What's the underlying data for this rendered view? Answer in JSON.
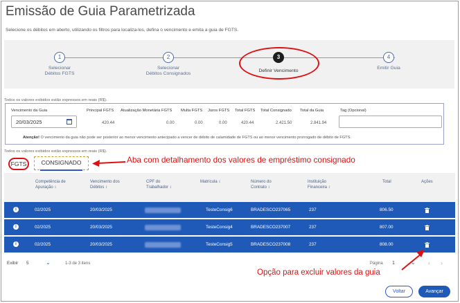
{
  "header": {
    "title": "Emissão de Guia Parametrizada",
    "subtitle": "Selecione os débitos em aberto, utilizando os filtros para localiza-los, defina o vencimento e emita a guia de FGTS."
  },
  "stepper": {
    "steps": [
      {
        "number": "1",
        "label_line1": "Selecionar",
        "label_line2": "Débitos FGTS"
      },
      {
        "number": "2",
        "label_line1": "Selecionar",
        "label_line2": "Débitos Consignados"
      },
      {
        "number": "3",
        "label_line1": "Definir Vencimento",
        "label_line2": ""
      },
      {
        "number": "4",
        "label_line1": "Emitir Guia",
        "label_line2": ""
      }
    ],
    "active_step": 3
  },
  "notes": {
    "reais_top": "Todos os valores exibidos estão expressos em reais (R$).",
    "reais_mid": "Todos os valores exibidos estão expressos em reais (R$)."
  },
  "vencimento": {
    "headers": {
      "vencimento": "Vencimento da Guia",
      "principal": "Principal FGTS",
      "atualizacao": "Atualização Monetária FGTS",
      "multa": "Multa FGTS",
      "juros": "Juros FGTS",
      "total_fgts": "Total FGTS",
      "total_consig": "Total Consignado",
      "total_guia": "Total da Guia",
      "tag": "Tag (Opcional)"
    },
    "values": {
      "vencimento": "20/03/2025",
      "principal": "420.44",
      "atualizacao": "0.00",
      "multa": "0.00",
      "juros": "0.00",
      "total_fgts": "420.44",
      "total_consig": "2.421.50",
      "total_guia": "2.841.94",
      "tag": ""
    },
    "atencao_label": "Atenção!",
    "atencao_text": " O vencimento da guia não pode ser posterior ao menor vencimento antecipado a vencer de débito de calamidade de FGTS ou ao menor vencimento prorrogado de débito de FGTS."
  },
  "tabs": {
    "fgts": "FGTS",
    "consignado": "CONSIGNADO"
  },
  "annotations": {
    "consig": "Aba com detalhamento dos valores de empréstimo consignado",
    "excluir": "Opção para excluir valores da guia"
  },
  "table": {
    "columns": {
      "competencia_1": "Competência de",
      "competencia_2": "Apuração ↕",
      "vencimento_1": "Vencimento dos",
      "vencimento_2": "Débitos ↕",
      "cpf_1": "CPF do",
      "cpf_2": "Trabalhador ↕",
      "matricula": "Matrícula ↕",
      "contrato_1": "Número do",
      "contrato_2": "Contrato ↕",
      "instituicao_1": "Instituição",
      "instituicao_2": "Financeira ↕",
      "total": "Total",
      "acoes": "Ações"
    },
    "rows": [
      {
        "competencia": "02/2025",
        "vencimento": "20/03/2025",
        "matricula": "TesteConsig6",
        "contrato": "BRADESCO237065",
        "instituicao": "237",
        "total": "806.50"
      },
      {
        "competencia": "02/2025",
        "vencimento": "20/03/2025",
        "matricula": "TesteConsig4",
        "contrato": "BRADESCO237007",
        "instituicao": "237",
        "total": "807.00"
      },
      {
        "competencia": "02/2025",
        "vencimento": "20/03/2025",
        "matricula": "TesteConsig5",
        "contrato": "BRADESCO237008",
        "instituicao": "237",
        "total": "808.00"
      }
    ]
  },
  "pagination": {
    "exibir_label": "Exibir",
    "exibir_value": "5",
    "items_text": "1-3 de 3 itens",
    "pagina_label": "Página",
    "pagina_value": "1"
  },
  "buttons": {
    "voltar": "Voltar",
    "avancar": "Avançar"
  },
  "colors": {
    "primary": "#1f5ab8",
    "annotation_red": "#dd1111",
    "dashed_gold": "#c8a020"
  },
  "icons": [
    "calendar-icon",
    "info-icon",
    "trash-icon",
    "chevron-down-icon",
    "chevron-left-icon",
    "chevron-right-icon"
  ]
}
